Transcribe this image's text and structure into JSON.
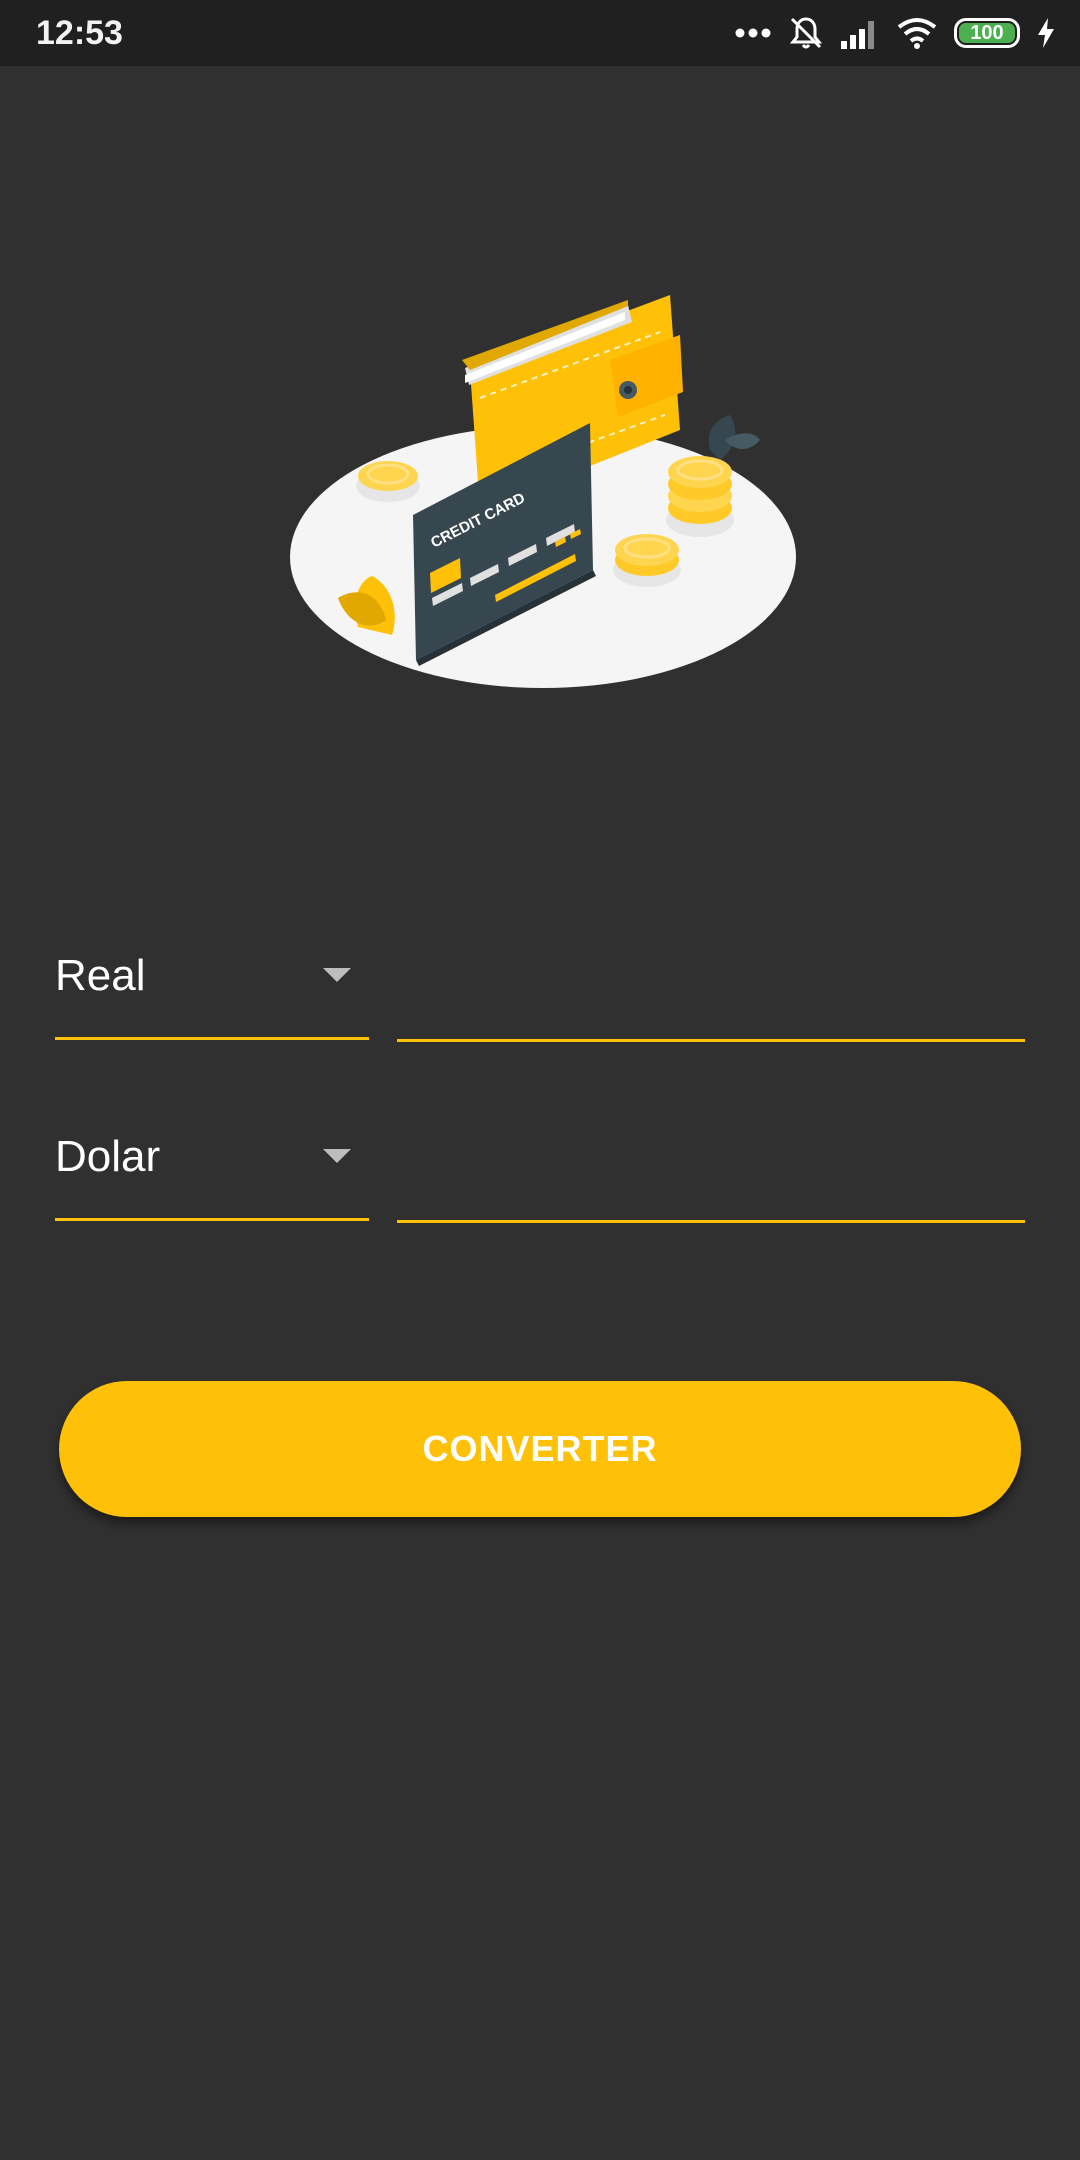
{
  "status_bar": {
    "time": "12:53",
    "battery": "100",
    "icons": [
      "more-dots-icon",
      "mute-icon",
      "signal-icon",
      "wifi-icon",
      "battery-icon",
      "charging-icon"
    ]
  },
  "illustration": {
    "card_text": "CREDIT CARD"
  },
  "form": {
    "from_currency": "Real",
    "to_currency": "Dolar",
    "from_amount": "",
    "to_amount": ""
  },
  "button": {
    "label": "CONVERTER"
  },
  "colors": {
    "background": "#303030",
    "accent": "#ffc107",
    "status_bar": "#202020"
  }
}
